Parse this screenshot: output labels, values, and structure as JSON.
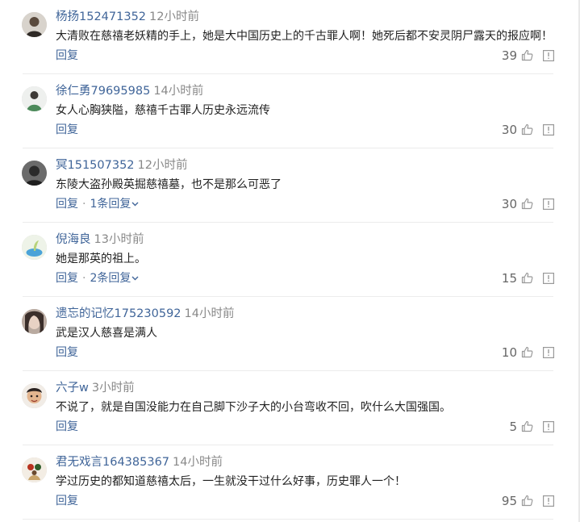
{
  "comments": [
    {
      "username": "杨扬152471352",
      "time": "12小时前",
      "text": "大清败在慈禧老妖精的手上，她是大中国历史上的千古罪人啊！她死后都不安灵阴尸露天的报应啊！",
      "reply_label": "回复",
      "replies_label": "",
      "likes": "39",
      "avatar_icon": "user-avatar-icon"
    },
    {
      "username": "徐仁勇79695985",
      "time": "14小时前",
      "text": "女人心胸狭隘，慈禧千古罪人历史永远流传",
      "reply_label": "回复",
      "replies_label": "",
      "likes": "30",
      "avatar_icon": "user-avatar-icon"
    },
    {
      "username": "冥151507352",
      "time": "12小时前",
      "text": "东陵大盗孙殿英掘慈禧墓，也不是那么可恶了",
      "reply_label": "回复",
      "replies_label": "1条回复",
      "likes": "30",
      "avatar_icon": "user-avatar-icon"
    },
    {
      "username": "倪海良",
      "time": "13小时前",
      "text": "她是那英的祖上。",
      "reply_label": "回复",
      "replies_label": "2条回复",
      "likes": "15",
      "avatar_icon": "user-avatar-icon"
    },
    {
      "username": "遗忘的记忆175230592",
      "time": "14小时前",
      "text": "武是汉人慈喜是满人",
      "reply_label": "回复",
      "replies_label": "",
      "likes": "10",
      "avatar_icon": "user-avatar-icon"
    },
    {
      "username": "六子w",
      "time": "3小时前",
      "text": "不说了，就是自国没能力在自己脚下沙子大的小台弯收不回，吹什么大国强国。",
      "reply_label": "回复",
      "replies_label": "",
      "likes": "5",
      "avatar_icon": "user-avatar-icon"
    },
    {
      "username": "君无戏言164385367",
      "time": "14小时前",
      "text": "学过历史的都知道慈禧太后，一生就没干过什么好事，历史罪人一个！",
      "reply_label": "回复",
      "replies_label": "",
      "likes": "95",
      "avatar_icon": "user-avatar-icon"
    }
  ],
  "colors": {
    "link": "#406599",
    "meta": "#888888",
    "text": "#222222",
    "icon": "#999999",
    "divider": "#ececec"
  }
}
